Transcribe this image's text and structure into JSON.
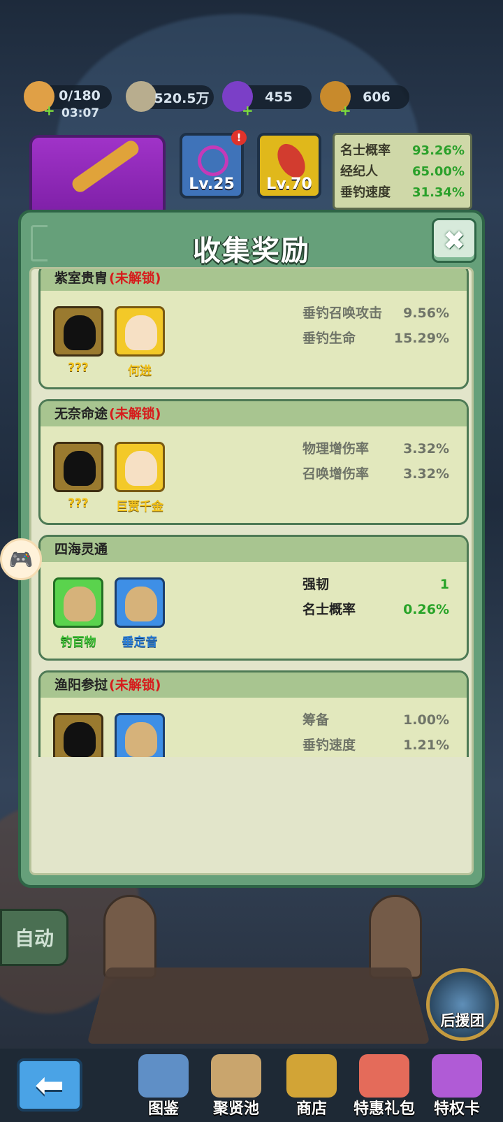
{
  "resources": {
    "stamina": {
      "value": "0/180",
      "timer": "03:07",
      "icon": "stamina-icon"
    },
    "coins": {
      "value": "520.5万",
      "icon": "coin-icon"
    },
    "gems": {
      "value": "455",
      "icon": "purple-gem-icon"
    },
    "chests": {
      "value": "606",
      "icon": "chest-icon"
    }
  },
  "gear": {
    "line_level": "Lv.25",
    "float_level": "Lv.70"
  },
  "stats": [
    {
      "label": "名士概率",
      "value": "93.26%"
    },
    {
      "label": "经纪人",
      "value": "65.00%"
    },
    {
      "label": "垂钓速度",
      "value": "31.34%"
    }
  ],
  "dialog": {
    "title": "收集奖励",
    "locked_suffix": "(未解锁)",
    "sets": [
      {
        "name": "紫室贵胄",
        "locked": true,
        "heroes": [
          {
            "name": "???",
            "style": "dark"
          },
          {
            "name": "何进",
            "style": "gold"
          }
        ],
        "bonuses": [
          {
            "label": "垂钓召唤攻击",
            "value": "9.56%"
          },
          {
            "label": "垂钓生命",
            "value": "15.29%"
          }
        ]
      },
      {
        "name": "无奈命途",
        "locked": true,
        "heroes": [
          {
            "name": "???",
            "style": "dark"
          },
          {
            "name": "巨贾千金",
            "style": "gold"
          }
        ],
        "bonuses": [
          {
            "label": "物理增伤率",
            "value": "3.32%"
          },
          {
            "label": "召唤增伤率",
            "value": "3.32%"
          }
        ]
      },
      {
        "name": "四海灵通",
        "locked": false,
        "heroes": [
          {
            "name": "钓百物",
            "style": "green"
          },
          {
            "name": "垂定音",
            "style": "blue"
          }
        ],
        "bonuses": [
          {
            "label": "强韧",
            "value": "1"
          },
          {
            "label": "名士概率",
            "value": "0.26%"
          }
        ]
      },
      {
        "name": "渔阳参挝",
        "locked": true,
        "heroes": [
          {
            "name": "",
            "style": "dark"
          },
          {
            "name": "",
            "style": "blue"
          }
        ],
        "bonuses": [
          {
            "label": "筹备",
            "value": "1.00%"
          },
          {
            "label": "垂钓速度",
            "value": "1.21%"
          }
        ]
      }
    ]
  },
  "auto_label": "自动",
  "support_label": "后援团",
  "nav": {
    "back_icon": "back-arrow-icon",
    "items": [
      {
        "label": "图鉴",
        "icon": "map-book-icon",
        "color": "#5f8fc6"
      },
      {
        "label": "聚贤池",
        "icon": "scroll-map-icon",
        "color": "#c9a56d"
      },
      {
        "label": "商店",
        "icon": "shop-basket-icon",
        "color": "#d2a436"
      },
      {
        "label": "特惠礼包",
        "icon": "gift-pack-icon",
        "color": "#e46b5a"
      },
      {
        "label": "特权卡",
        "icon": "privilege-card-icon",
        "color": "#b05bd6"
      }
    ]
  },
  "colors": {
    "dialog_frame": "#66a07a",
    "locked_text": "#d61c1c",
    "active_value": "#27a327"
  }
}
